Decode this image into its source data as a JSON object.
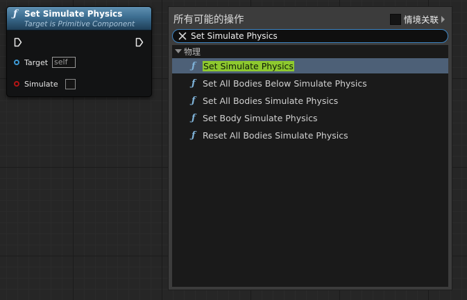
{
  "node": {
    "func_icon": "ƒ",
    "title": "Set Simulate Physics",
    "subtitle": "Target is Primitive Component",
    "pins": {
      "target_label": "Target",
      "target_value": "self",
      "simulate_label": "Simulate"
    },
    "colors": {
      "header": "#3c6d90",
      "target_pin": "#3d9ad6",
      "simulate_pin": "#b41515"
    }
  },
  "menu": {
    "title": "所有可能的操作",
    "context_label": "情境关联",
    "search": {
      "value": "Set Simulate Physics"
    },
    "category": "物理",
    "item_icon": "ƒ",
    "items": [
      {
        "label": "Set Simulate Physics",
        "selected": true
      },
      {
        "label": "Set All Bodies Below Simulate Physics",
        "selected": false
      },
      {
        "label": "Set All Bodies Simulate Physics",
        "selected": false
      },
      {
        "label": "Set Body Simulate Physics",
        "selected": false
      },
      {
        "label": "Reset All Bodies Simulate Physics",
        "selected": false
      }
    ],
    "colors": {
      "selection": "#4d6077",
      "highlight": "#8ec92f",
      "search_border": "#3e86c5"
    }
  }
}
